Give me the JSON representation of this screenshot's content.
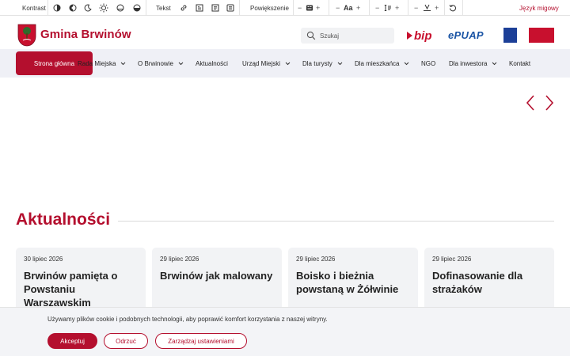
{
  "toolbar": {
    "contrast_label": "Kontrast",
    "text_label": "Tekst",
    "zoom_label": "Powiększenie",
    "font_size_glyph": "Aa",
    "sign_language_label": "Język migowy",
    "icons": [
      "contrast-half-icon",
      "contrast-invert-icon",
      "dark-mode-icon",
      "light-mode-icon",
      "grayscale-icon",
      "high-contrast-icon",
      "link-icon",
      "reader-icon",
      "text-align-icon",
      "readable-font-icon",
      "zoom-icon",
      "font-size-icon",
      "line-height-icon",
      "letter-spacing-icon",
      "reset-icon"
    ]
  },
  "header": {
    "site_name": "Gmina Brwinów",
    "search_placeholder": "Szukaj",
    "bip_label": "bip",
    "epuap_label": "ePUAP"
  },
  "nav": {
    "items": [
      {
        "label": "Strona główna",
        "active": true,
        "has_dropdown": false
      },
      {
        "label": "Rada Miejska",
        "active": false,
        "has_dropdown": true
      },
      {
        "label": "O Brwinowie",
        "active": false,
        "has_dropdown": true
      },
      {
        "label": "Aktualności",
        "active": false,
        "has_dropdown": false
      },
      {
        "label": "Urząd Miejski",
        "active": false,
        "has_dropdown": true
      },
      {
        "label": "Dla turysty",
        "active": false,
        "has_dropdown": true
      },
      {
        "label": "Dla mieszkańca",
        "active": false,
        "has_dropdown": true
      },
      {
        "label": "NGO",
        "active": false,
        "has_dropdown": false
      },
      {
        "label": "Dla inwestora",
        "active": false,
        "has_dropdown": true
      },
      {
        "label": "Kontakt",
        "active": false,
        "has_dropdown": false
      }
    ]
  },
  "news": {
    "title": "Aktualności",
    "cards": [
      {
        "date": "30 lipiec 2026",
        "title": "Brwinów pamięta o Powstaniu Warszawskim"
      },
      {
        "date": "29 lipiec 2026",
        "title": "Brwinów jak malowany"
      },
      {
        "date": "29 lipiec 2026",
        "title": "Boisko i bieżnia powstaną w Żółwinie"
      },
      {
        "date": "29 lipiec 2026",
        "title": "Dofinasowanie dla strażaków"
      }
    ]
  },
  "cookie": {
    "message": "Używamy plików cookie i podobnych technologii, aby poprawić komfort korzystania z naszej witryny.",
    "accept_label": "Akceptuj",
    "reject_label": "Odrzuć",
    "manage_label": "Zarządzaj ustawieniami"
  },
  "colors": {
    "brand": "#b40f2e",
    "nav_bg": "#eff0f6",
    "card_bg": "#f2f3f5",
    "cookie_bg": "#f3f4f7"
  }
}
